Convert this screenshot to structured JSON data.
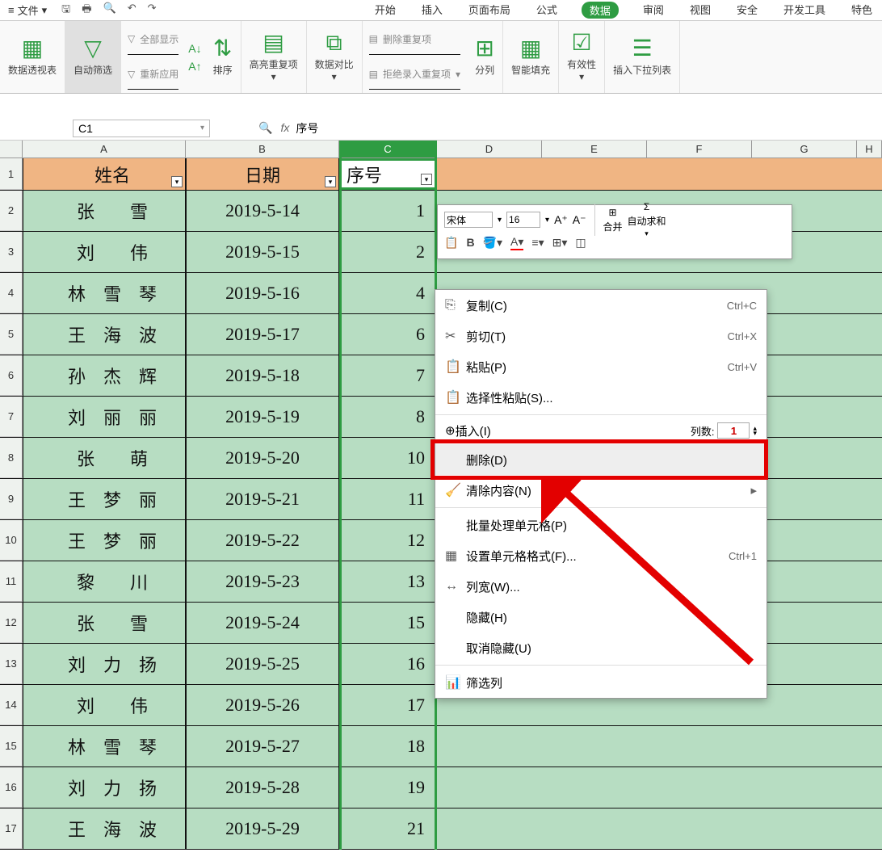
{
  "menubar": {
    "file": "文件",
    "tabs": [
      "开始",
      "插入",
      "页面布局",
      "公式",
      "数据",
      "审阅",
      "视图",
      "安全",
      "开发工具",
      "特色"
    ]
  },
  "ribbon": {
    "pivot": "数据透视表",
    "filter": "自动筛选",
    "showall": "全部显示",
    "reapply": "重新应用",
    "sort": "排序",
    "highlight": "高亮重复项",
    "compare": "数据对比",
    "del_dup": "删除重复项",
    "reject_dup": "拒绝录入重复项",
    "splitcol": "分列",
    "smartfill": "智能填充",
    "validation": "有效性",
    "dropdown_insert": "插入下拉列表"
  },
  "fxbar": {
    "name": "C1",
    "fx": "fx",
    "value": "序号"
  },
  "columns": [
    "A",
    "B",
    "C",
    "D",
    "E",
    "F",
    "G",
    "H"
  ],
  "headers": {
    "A": "姓名",
    "B": "日期",
    "C": "序号"
  },
  "rows": [
    {
      "n": "1"
    },
    {
      "n": "2",
      "a": "张　　雪",
      "b": "2019-5-14",
      "c": "1"
    },
    {
      "n": "3",
      "a": "刘　　伟",
      "b": "2019-5-15",
      "c": "2"
    },
    {
      "n": "4",
      "a": "林　雪　琴",
      "b": "2019-5-16",
      "c": "4"
    },
    {
      "n": "5",
      "a": "王　海　波",
      "b": "2019-5-17",
      "c": "6"
    },
    {
      "n": "6",
      "a": "孙　杰　辉",
      "b": "2019-5-18",
      "c": "7"
    },
    {
      "n": "7",
      "a": "刘　丽　丽",
      "b": "2019-5-19",
      "c": "8"
    },
    {
      "n": "8",
      "a": "张　　萌",
      "b": "2019-5-20",
      "c": "10"
    },
    {
      "n": "9",
      "a": "王　梦　丽",
      "b": "2019-5-21",
      "c": "11"
    },
    {
      "n": "10",
      "a": "王　梦　丽",
      "b": "2019-5-22",
      "c": "12"
    },
    {
      "n": "11",
      "a": "黎　　川",
      "b": "2019-5-23",
      "c": "13"
    },
    {
      "n": "12",
      "a": "张　　雪",
      "b": "2019-5-24",
      "c": "15"
    },
    {
      "n": "13",
      "a": "刘　力　扬",
      "b": "2019-5-25",
      "c": "16"
    },
    {
      "n": "14",
      "a": "刘　　伟",
      "b": "2019-5-26",
      "c": "17"
    },
    {
      "n": "15",
      "a": "林　雪　琴",
      "b": "2019-5-27",
      "c": "18"
    },
    {
      "n": "16",
      "a": "刘　力　扬",
      "b": "2019-5-28",
      "c": "19"
    },
    {
      "n": "17",
      "a": "王　海　波",
      "b": "2019-5-29",
      "c": "21"
    }
  ],
  "minitb": {
    "font": "宋体",
    "size": "16",
    "merge": "合并",
    "autosum": "自动求和"
  },
  "ctx": {
    "copy": "复制(C)",
    "copy_sc": "Ctrl+C",
    "cut": "剪切(T)",
    "cut_sc": "Ctrl+X",
    "paste": "粘贴(P)",
    "paste_sc": "Ctrl+V",
    "paste_special": "选择性粘贴(S)...",
    "insert": "插入(I)",
    "insert_label": "列数:",
    "insert_count": "1",
    "delete": "删除(D)",
    "clear": "清除内容(N)",
    "batch": "批量处理单元格(P)",
    "format": "设置单元格格式(F)...",
    "format_sc": "Ctrl+1",
    "colwidth": "列宽(W)...",
    "hide": "隐藏(H)",
    "unhide": "取消隐藏(U)",
    "filtercol": "筛选列"
  }
}
